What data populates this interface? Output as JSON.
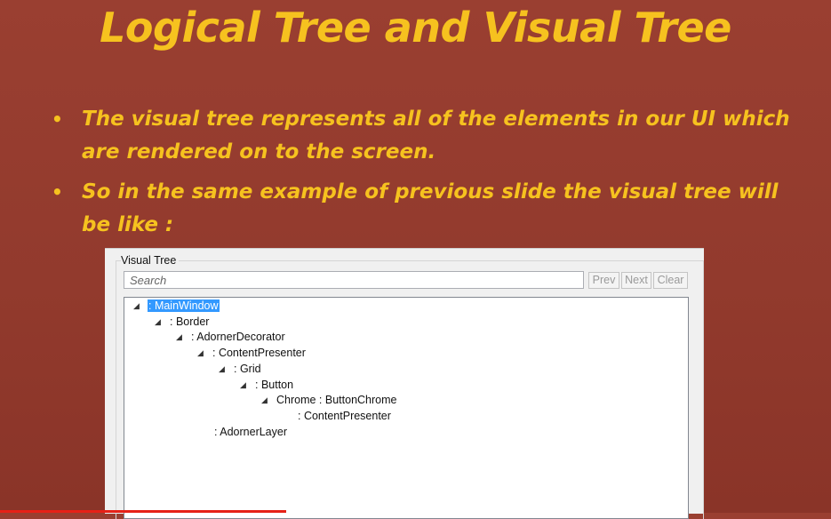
{
  "slide": {
    "title": "Logical Tree and Visual Tree",
    "bullets": [
      {
        "text": "The visual tree represents all of the elements in our UI which are rendered on to the screen."
      },
      {
        "text": "So in the same example of previous slide the visual tree will be like :"
      }
    ]
  },
  "visual_tree_panel": {
    "group_label": "Visual Tree",
    "search": {
      "placeholder": "Search",
      "value": ""
    },
    "buttons": {
      "prev": "Prev",
      "next": "Next",
      "clear": "Clear"
    },
    "nodes": [
      {
        "label": ": MainWindow",
        "expanded": true,
        "selected": true
      },
      {
        "label": ": Border",
        "expanded": true
      },
      {
        "label": ": AdornerDecorator",
        "expanded": true
      },
      {
        "label": ": ContentPresenter",
        "expanded": true
      },
      {
        "label": ": Grid",
        "expanded": true
      },
      {
        "label": ": Button",
        "expanded": true
      },
      {
        "label": "Chrome : ButtonChrome",
        "expanded": true
      },
      {
        "label": ": ContentPresenter",
        "expanded": false
      },
      {
        "label": ": AdornerLayer",
        "expanded": false
      }
    ]
  },
  "colors": {
    "background": "#96392c",
    "title": "#f6c21f",
    "selection": "#3399ff",
    "progress": "#e62117"
  },
  "icons": {
    "bullet": "bullet-dot",
    "expander": "expanded-triangle-icon"
  }
}
